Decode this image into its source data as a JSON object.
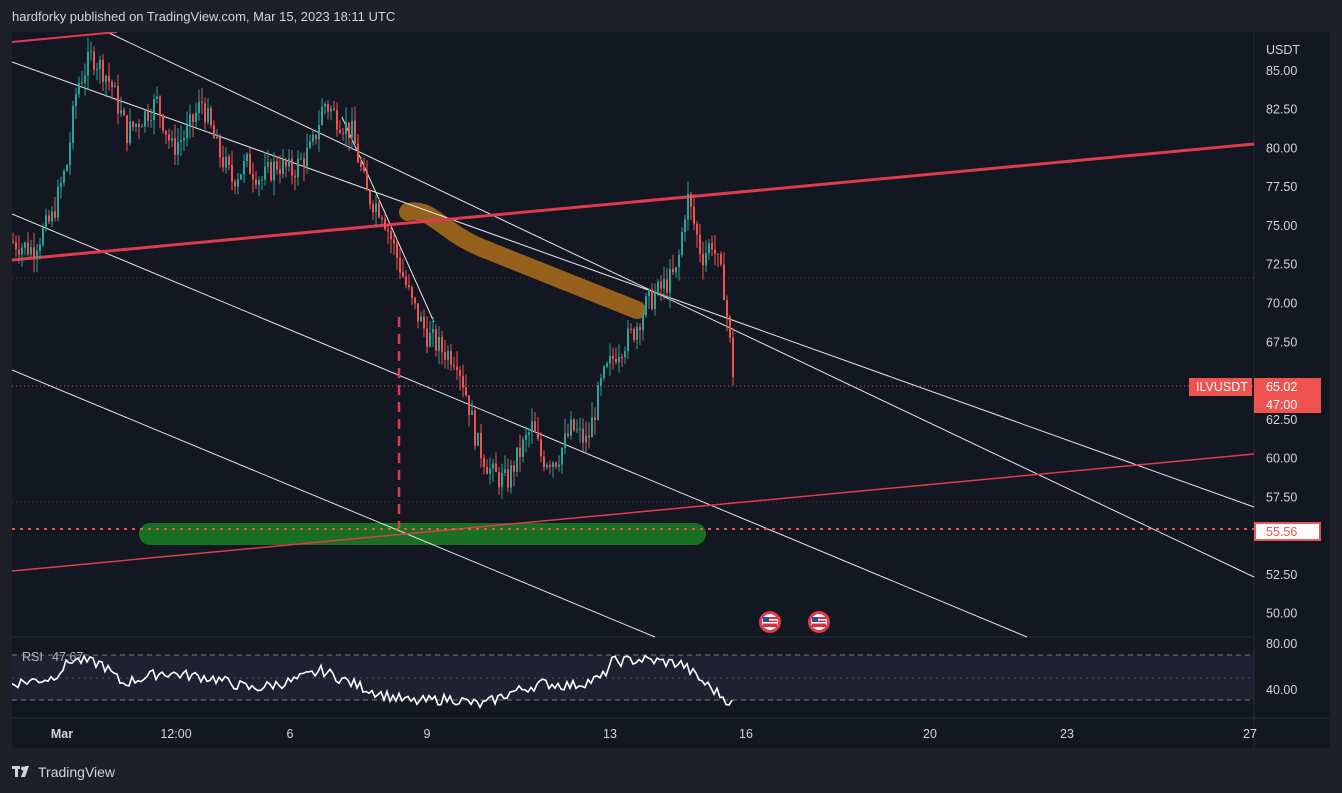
{
  "header": {
    "text": "hardforky published on TradingView.com, Mar 15, 2023 18:11 UTC"
  },
  "footer": {
    "brand": "TradingView"
  },
  "chart_data": {
    "type": "candlestick",
    "symbol": "ILVUSDT",
    "currency": "USDT",
    "last_price": "65.02",
    "countdown": "47:00",
    "horizontal_level": "55.56",
    "y_ticks": [
      "85.00",
      "82.50",
      "80.00",
      "77.50",
      "75.00",
      "72.50",
      "70.00",
      "67.50",
      "62.50",
      "60.00",
      "57.50",
      "52.50",
      "50.00"
    ],
    "y_range": [
      48.5,
      87.5
    ],
    "x_ticks": [
      "Mar",
      "12:00",
      "6",
      "9",
      "13",
      "16",
      "20",
      "23",
      "27"
    ],
    "indicator": {
      "name": "RSI",
      "value_label": "47.67",
      "ticks": [
        "80.00",
        "40.00"
      ],
      "upper_band": 70,
      "lower_band": 30
    },
    "colors": {
      "up": "#26a69a",
      "down": "#ef5350",
      "trendline_red": "#e03a4e",
      "channel_white": "#e6e6e6",
      "highlight_orange": "#c27a1a",
      "highlight_green": "#1c7a22",
      "rsi_line": "#ffffff"
    },
    "icons": [
      "us-flag-icon",
      "us-flag-icon"
    ]
  }
}
